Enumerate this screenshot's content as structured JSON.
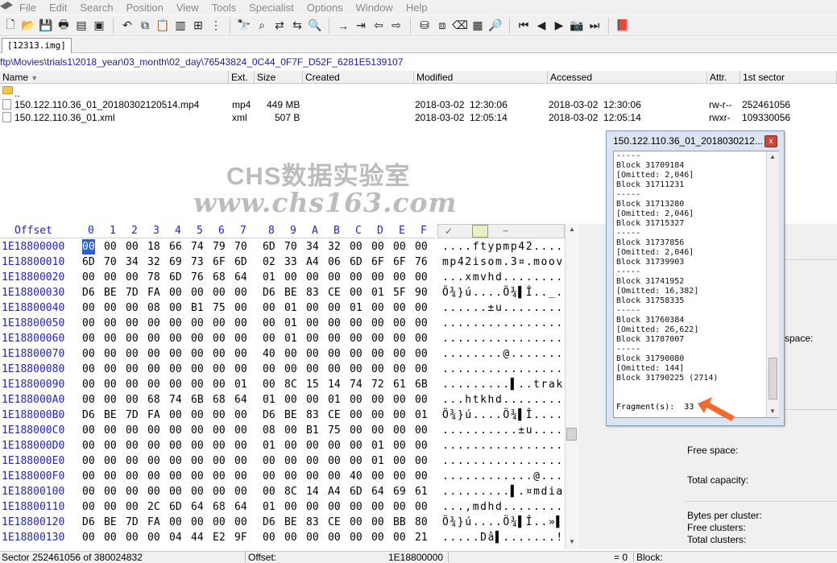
{
  "menu": [
    "File",
    "Edit",
    "Search",
    "Position",
    "View",
    "Tools",
    "Specialist",
    "Options",
    "Window",
    "Help"
  ],
  "tab": "[12313.img]",
  "path": "ftp\\Movies\\trials1\\2018_year\\03_month\\02_day\\76543824_0C44_0F7F_D52F_6281E5139107",
  "columns": [
    "Name",
    "Ext.",
    "Size",
    "Created",
    "Modified",
    "Accessed",
    "Attr.",
    "1st sector"
  ],
  "files": [
    {
      "name": "..",
      "ext": "",
      "size": "",
      "created": "",
      "modified": "",
      "accessed": "",
      "attr": "",
      "sector": ""
    },
    {
      "name": "150.122.110.36_01_20180302120514.mp4",
      "ext": "mp4",
      "size": "449 MB",
      "created": "",
      "modified": "2018-03-02  12:30:06",
      "accessed": "2018-03-02  12:30:06",
      "attr": "rw-r--",
      "sector": "252461056"
    },
    {
      "name": "150.122.110.36_01.xml",
      "ext": "xml",
      "size": "507 B",
      "created": "",
      "modified": "2018-03-02  12:05:14",
      "accessed": "2018-03-02  12:05:14",
      "attr": "rwxr-",
      "sector": "109330056"
    }
  ],
  "watermark": {
    "line1": "CHS数据实验室",
    "line2": "www.chs163.com"
  },
  "hex": {
    "offset_label": "Offset",
    "cols": [
      "0",
      "1",
      "2",
      "3",
      "4",
      "5",
      "6",
      "7",
      "8",
      "9",
      "A",
      "B",
      "C",
      "D",
      "E",
      "F"
    ],
    "rows": [
      {
        "off": "1E18800000",
        "bytes": [
          "00",
          "00",
          "00",
          "18",
          "66",
          "74",
          "79",
          "70",
          "6D",
          "70",
          "34",
          "32",
          "00",
          "00",
          "00",
          "00"
        ],
        "ascii": "....ftypmp42...."
      },
      {
        "off": "1E18800010",
        "bytes": [
          "6D",
          "70",
          "34",
          "32",
          "69",
          "73",
          "6F",
          "6D",
          "02",
          "33",
          "A4",
          "06",
          "6D",
          "6F",
          "6F",
          "76"
        ],
        "ascii": "mp42isom.3¤.moov"
      },
      {
        "off": "1E18800020",
        "bytes": [
          "00",
          "00",
          "00",
          "78",
          "6D",
          "76",
          "68",
          "64",
          "01",
          "00",
          "00",
          "00",
          "00",
          "00",
          "00",
          "00"
        ],
        "ascii": "...xmvhd........"
      },
      {
        "off": "1E18800030",
        "bytes": [
          "D6",
          "BE",
          "7D",
          "FA",
          "00",
          "00",
          "00",
          "00",
          "D6",
          "BE",
          "83",
          "CE",
          "00",
          "01",
          "5F",
          "90"
        ],
        "ascii": "Ö¾}ú....Ö¾▌Î.._."
      },
      {
        "off": "1E18800040",
        "bytes": [
          "00",
          "00",
          "00",
          "08",
          "00",
          "B1",
          "75",
          "00",
          "00",
          "01",
          "00",
          "00",
          "01",
          "00",
          "00",
          "00"
        ],
        "ascii": "......±u........"
      },
      {
        "off": "1E18800050",
        "bytes": [
          "00",
          "00",
          "00",
          "00",
          "00",
          "00",
          "00",
          "00",
          "00",
          "01",
          "00",
          "00",
          "00",
          "00",
          "00",
          "00"
        ],
        "ascii": "................"
      },
      {
        "off": "1E18800060",
        "bytes": [
          "00",
          "00",
          "00",
          "00",
          "00",
          "00",
          "00",
          "00",
          "00",
          "01",
          "00",
          "00",
          "00",
          "00",
          "00",
          "00"
        ],
        "ascii": "................"
      },
      {
        "off": "1E18800070",
        "bytes": [
          "00",
          "00",
          "00",
          "00",
          "00",
          "00",
          "00",
          "00",
          "40",
          "00",
          "00",
          "00",
          "00",
          "00",
          "00",
          "00"
        ],
        "ascii": "........@......."
      },
      {
        "off": "1E18800080",
        "bytes": [
          "00",
          "00",
          "00",
          "00",
          "00",
          "00",
          "00",
          "00",
          "00",
          "00",
          "00",
          "00",
          "00",
          "00",
          "00",
          "00"
        ],
        "ascii": "................"
      },
      {
        "off": "1E18800090",
        "bytes": [
          "00",
          "00",
          "00",
          "00",
          "00",
          "00",
          "00",
          "01",
          "00",
          "8C",
          "15",
          "14",
          "74",
          "72",
          "61",
          "6B"
        ],
        "ascii": ".........▌..trak"
      },
      {
        "off": "1E188000A0",
        "bytes": [
          "00",
          "00",
          "00",
          "68",
          "74",
          "6B",
          "68",
          "64",
          "01",
          "00",
          "00",
          "01",
          "00",
          "00",
          "00",
          "00"
        ],
        "ascii": "...htkhd........"
      },
      {
        "off": "1E188000B0",
        "bytes": [
          "D6",
          "BE",
          "7D",
          "FA",
          "00",
          "00",
          "00",
          "00",
          "D6",
          "BE",
          "83",
          "CE",
          "00",
          "00",
          "00",
          "01"
        ],
        "ascii": "Ö¾}ú....Ö¾▌Î...."
      },
      {
        "off": "1E188000C0",
        "bytes": [
          "00",
          "00",
          "00",
          "00",
          "00",
          "00",
          "00",
          "00",
          "08",
          "00",
          "B1",
          "75",
          "00",
          "00",
          "00",
          "00"
        ],
        "ascii": "..........±u...."
      },
      {
        "off": "1E188000D0",
        "bytes": [
          "00",
          "00",
          "00",
          "00",
          "00",
          "00",
          "00",
          "00",
          "01",
          "00",
          "00",
          "00",
          "00",
          "01",
          "00",
          "00"
        ],
        "ascii": "................"
      },
      {
        "off": "1E188000E0",
        "bytes": [
          "00",
          "00",
          "00",
          "00",
          "00",
          "00",
          "00",
          "00",
          "00",
          "00",
          "00",
          "00",
          "00",
          "01",
          "00",
          "00"
        ],
        "ascii": "................"
      },
      {
        "off": "1E188000F0",
        "bytes": [
          "00",
          "00",
          "00",
          "00",
          "00",
          "00",
          "00",
          "00",
          "00",
          "00",
          "00",
          "00",
          "40",
          "00",
          "00",
          "00"
        ],
        "ascii": "............@..."
      },
      {
        "off": "1E18800100",
        "bytes": [
          "00",
          "00",
          "00",
          "00",
          "00",
          "00",
          "00",
          "00",
          "00",
          "8C",
          "14",
          "A4",
          "6D",
          "64",
          "69",
          "61"
        ],
        "ascii": ".........▌.¤mdia"
      },
      {
        "off": "1E18800110",
        "bytes": [
          "00",
          "00",
          "00",
          "2C",
          "6D",
          "64",
          "68",
          "64",
          "01",
          "00",
          "00",
          "00",
          "00",
          "00",
          "00",
          "00"
        ],
        "ascii": "...,mdhd........"
      },
      {
        "off": "1E18800120",
        "bytes": [
          "D6",
          "BE",
          "7D",
          "FA",
          "00",
          "00",
          "00",
          "00",
          "D6",
          "BE",
          "83",
          "CE",
          "00",
          "00",
          "BB",
          "80"
        ],
        "ascii": "Ö¾}ú....Ö¾▌Î..»▌"
      },
      {
        "off": "1E18800130",
        "bytes": [
          "00",
          "00",
          "00",
          "00",
          "04",
          "44",
          "E2",
          "9F",
          "00",
          "00",
          "00",
          "00",
          "00",
          "00",
          "00",
          "21"
        ],
        "ascii": ".....Dâ▌.......!"
      }
    ]
  },
  "side": {
    "space_label": "space:",
    "free_space": "Free space:",
    "total_capacity": "Total capacity:",
    "bytes_per_cluster": "Bytes per cluster:",
    "free_clusters": "Free clusters:",
    "total_clusters": "Total clusters:"
  },
  "status": {
    "sector": "Sector 252461056 of 380024832",
    "offset_label": "Offset:",
    "offset_value": "1E18800000",
    "value": "= 0",
    "block": "Block:"
  },
  "popup": {
    "title": "150.122.110.36_01_2018030212...",
    "close": "x",
    "lines": [
      "-----",
      "Block 31709184",
      "[Omitted: 2,046]",
      "Block 31711231",
      "-----",
      "Block 31713280",
      "[Omitted: 2,046]",
      "Block 31715327",
      "-----",
      "Block 31737856",
      "[Omitted: 2,046]",
      "Block 31739903",
      "-----",
      "Block 31741952",
      "[Omitted: 16,382]",
      "Block 31758335",
      "-----",
      "Block 31760384",
      "[Omitted: 26,622]",
      "Block 31787007",
      "-----",
      "Block 31790080",
      "[Omitted: 144]",
      "Block 31790225 (2714)"
    ],
    "fragments_label": "Fragment(s):",
    "fragments_value": "33"
  },
  "colors": {
    "accent": "#2323c8",
    "arrow": "#f26a2c",
    "path": "#1a1aa6"
  }
}
